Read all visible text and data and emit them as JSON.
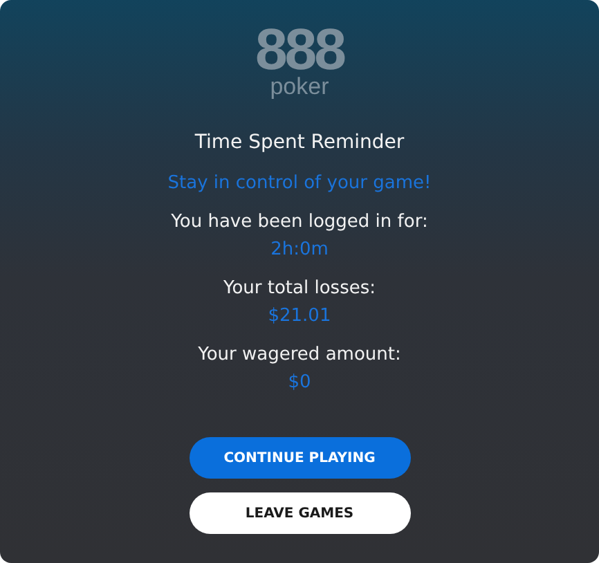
{
  "logo": {
    "mark": "888",
    "word": "poker"
  },
  "title": "Time Spent Reminder",
  "tagline": "Stay in control of your game!",
  "stats": [
    {
      "label": "You have been logged in for:",
      "value": "2h:0m"
    },
    {
      "label": "Your total losses:",
      "value": "$21.01"
    },
    {
      "label": "Your wagered amount:",
      "value": "$0"
    }
  ],
  "buttons": [
    {
      "label": "CONTINUE PLAYING",
      "kind": "primary"
    },
    {
      "label": "LEAVE GAMES",
      "kind": "secondary"
    }
  ]
}
